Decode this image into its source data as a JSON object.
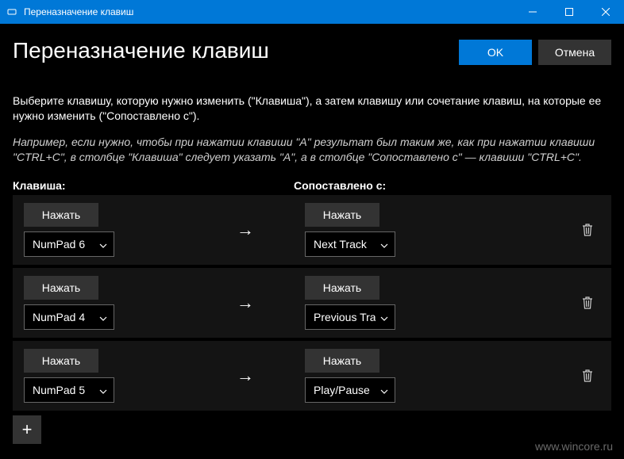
{
  "window": {
    "title": "Переназначение клавиш"
  },
  "header": {
    "page_title": "Переназначение клавиш",
    "ok_label": "OK",
    "cancel_label": "Отмена"
  },
  "description": "Выберите клавишу, которую нужно изменить (\"Клавиша\"), а затем клавишу или сочетание клавиш, на которые ее нужно изменить (\"Сопоставлено с\").",
  "example": "Например, если нужно, чтобы при нажатии клавиши \"A\" результат был таким же, как при нажатии клавиши \"CTRL+C\", в столбце \"Клавиша\" следует указать \"A\", а в столбце \"Сопоставлено с\" — клавиши \"CTRL+C\".",
  "columns": {
    "key_label": "Клавиша:",
    "mapped_label": "Сопоставлено с:"
  },
  "type_label": "Нажать",
  "mappings": [
    {
      "key": "NumPad 6",
      "mapped": "Next Track"
    },
    {
      "key": "NumPad 4",
      "mapped": "Previous Track"
    },
    {
      "key": "NumPad 5",
      "mapped": "Play/Pause"
    }
  ],
  "watermark": "www.wincore.ru"
}
